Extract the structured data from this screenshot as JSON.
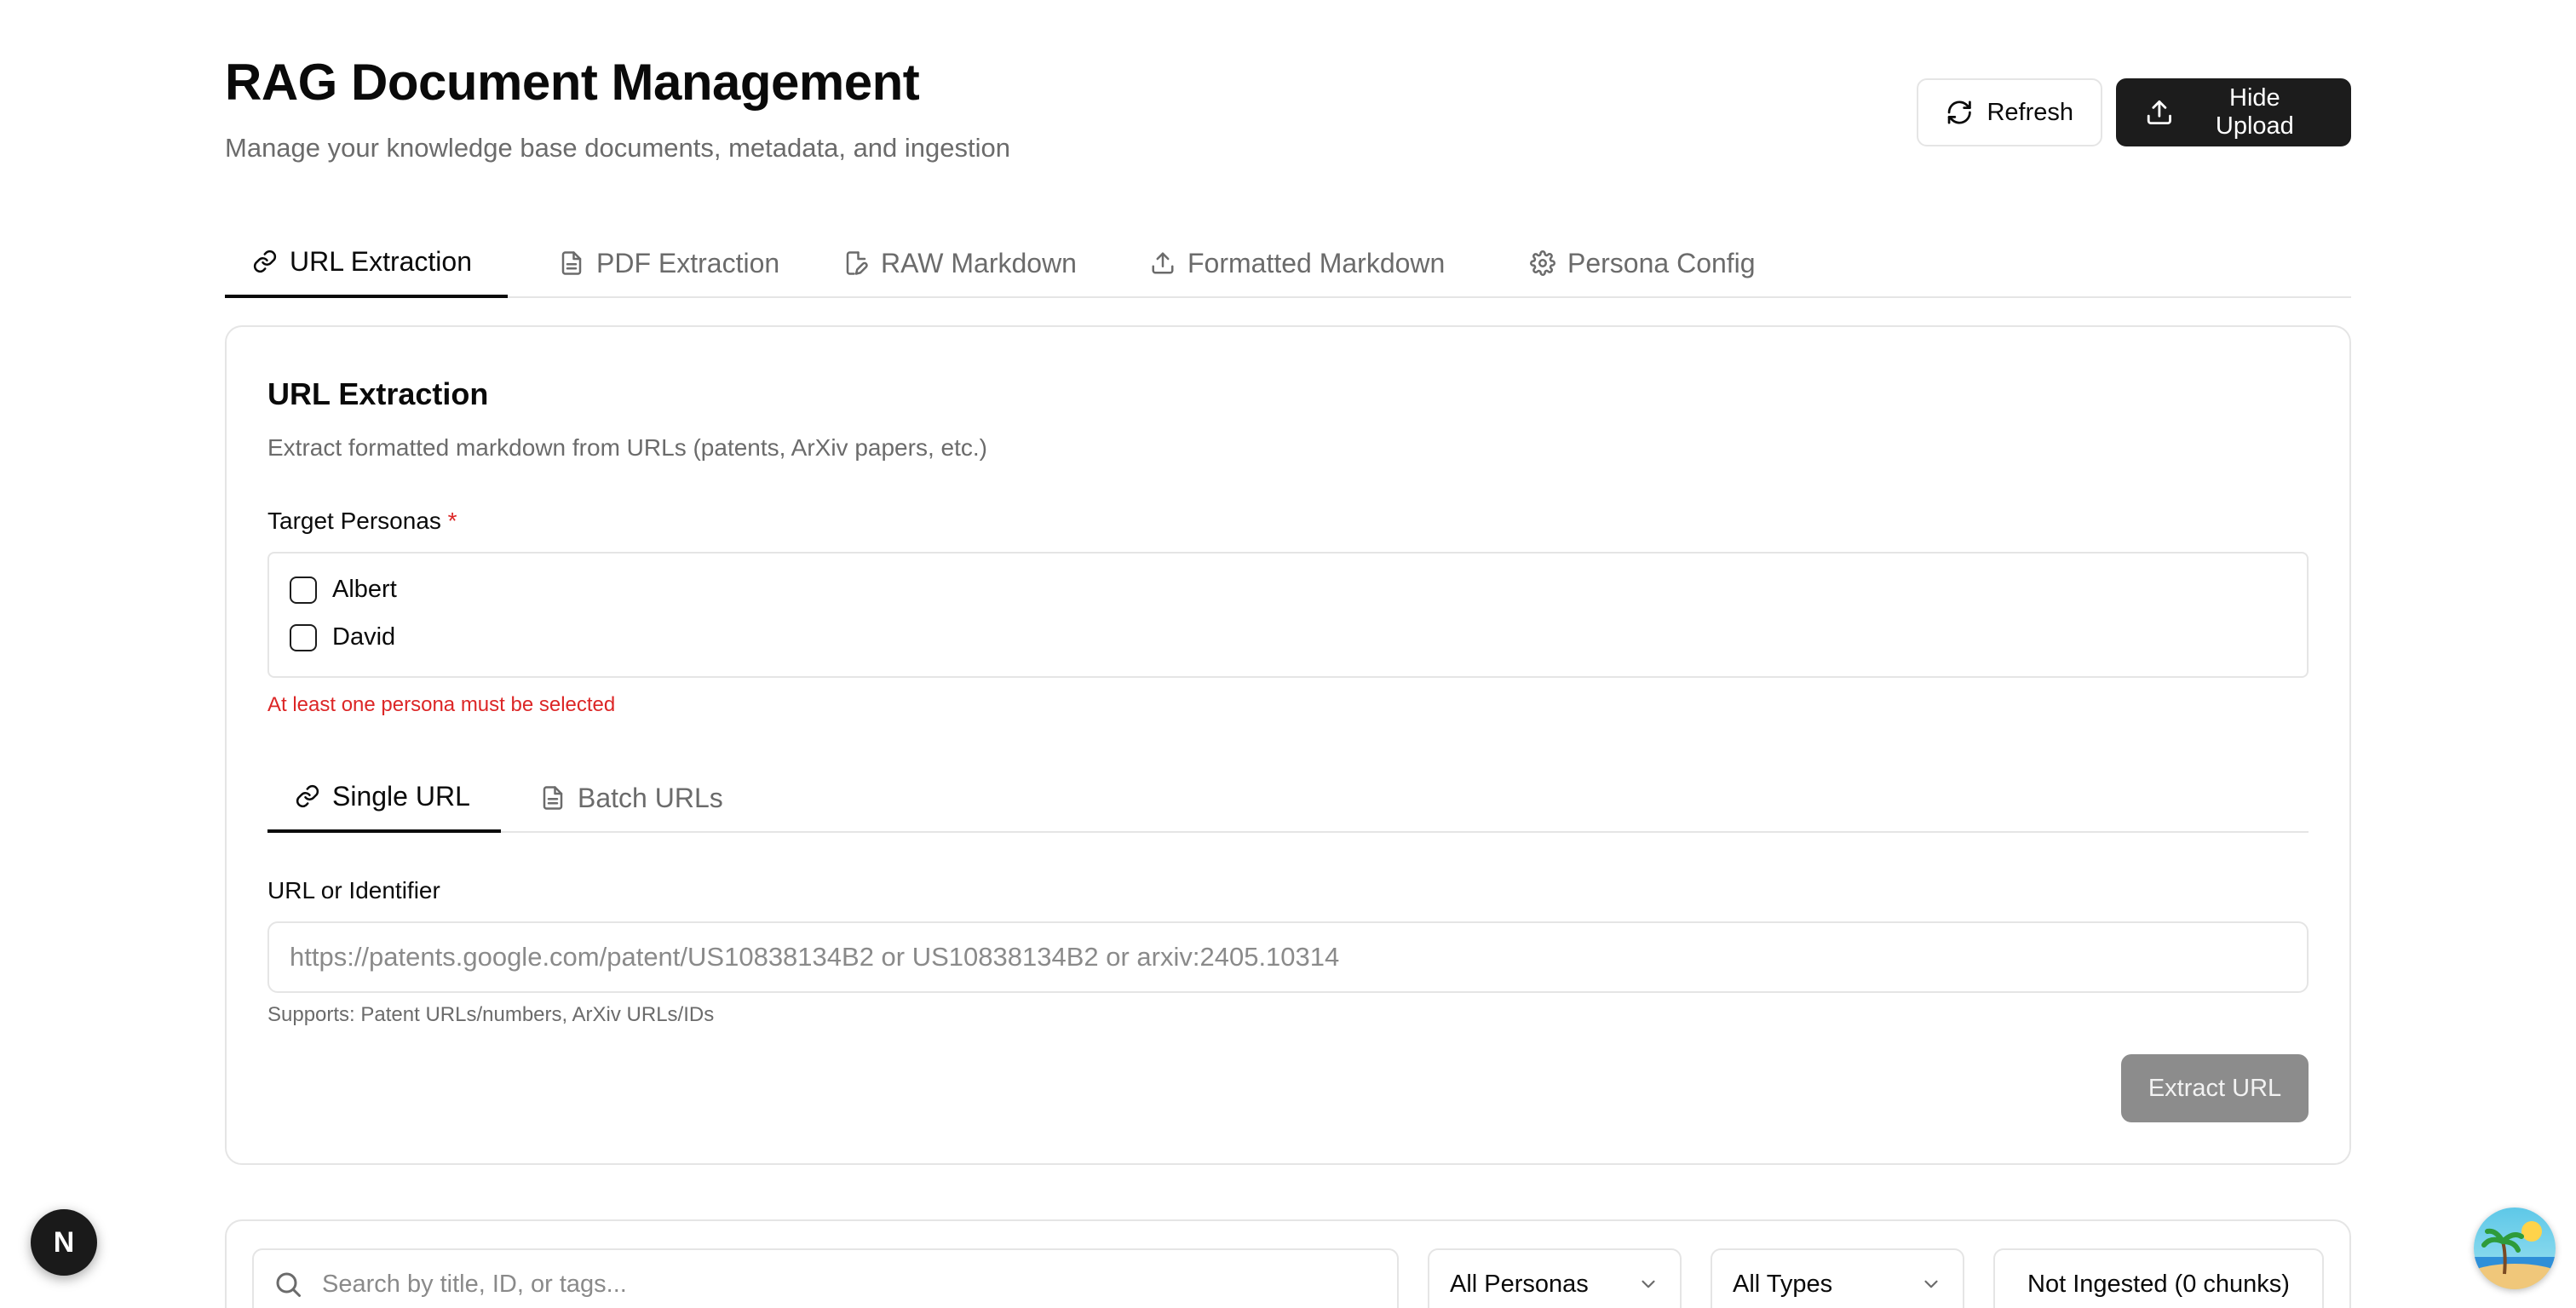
{
  "header": {
    "title": "RAG Document Management",
    "subtitle": "Manage your knowledge base documents, metadata, and ingestion",
    "refresh_label": "Refresh",
    "hide_upload_label": "Hide Upload"
  },
  "tabs": [
    {
      "label": "URL Extraction",
      "icon": "link-icon",
      "active": true
    },
    {
      "label": "PDF Extraction",
      "icon": "file-text-icon",
      "active": false
    },
    {
      "label": "RAW Markdown",
      "icon": "file-edit-icon",
      "active": false
    },
    {
      "label": "Formatted Markdown",
      "icon": "upload-icon",
      "active": false
    },
    {
      "label": "Persona Config",
      "icon": "gear-icon",
      "active": false
    }
  ],
  "card": {
    "title": "URL Extraction",
    "description": "Extract formatted markdown from URLs (patents, ArXiv papers, etc.)",
    "personas_label": "Target Personas",
    "required_mark": "*",
    "personas": [
      {
        "name": "Albert",
        "checked": false
      },
      {
        "name": "David",
        "checked": false
      }
    ],
    "personas_error": "At least one persona must be selected",
    "subtabs": [
      {
        "label": "Single URL",
        "icon": "link-icon",
        "active": true
      },
      {
        "label": "Batch URLs",
        "icon": "file-text-icon",
        "active": false
      }
    ],
    "url_label": "URL or Identifier",
    "url_value": "",
    "url_placeholder": "https://patents.google.com/patent/US10838134B2 or US10838134B2 or arxiv:2405.10314",
    "url_hint": "Supports: Patent URLs/numbers, ArXiv URLs/IDs",
    "extract_label": "Extract URL"
  },
  "filters": {
    "search_placeholder": "Search by title, ID, or tags...",
    "search_value": "",
    "personas_select": "All Personas",
    "types_select": "All Types",
    "status_label": "Not Ingested (0 chunks)"
  },
  "floating": {
    "next_badge_letter": "N"
  },
  "colors": {
    "primary": "#1c1c1c",
    "border": "#e5e5e5",
    "muted_text": "#6b6b6b",
    "error": "#dc2626",
    "disabled_button": "#8c8c8c"
  }
}
